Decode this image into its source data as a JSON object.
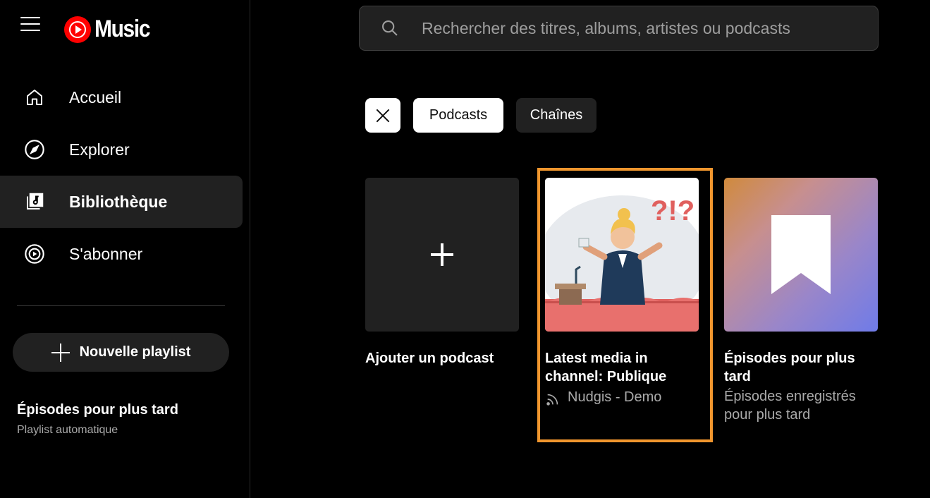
{
  "app": {
    "logo_text": "Music",
    "brand_color": "#ff0000",
    "highlight_color": "#f0962e"
  },
  "sidebar": {
    "items": [
      {
        "label": "Accueil",
        "icon": "home-icon",
        "active": false
      },
      {
        "label": "Explorer",
        "icon": "compass-icon",
        "active": false
      },
      {
        "label": "Bibliothèque",
        "icon": "library-icon",
        "active": true
      },
      {
        "label": "S'abonner",
        "icon": "subscriptions-icon",
        "active": false
      }
    ],
    "new_playlist_label": "Nouvelle playlist",
    "saved_playlist": {
      "title": "Épisodes pour plus tard",
      "subtitle": "Playlist automatique"
    }
  },
  "search": {
    "placeholder": "Rechercher des titres, albums, artistes ou podcasts"
  },
  "filters": {
    "chips": [
      {
        "label": "Podcasts",
        "selected": true
      },
      {
        "label": "Chaînes",
        "selected": false
      }
    ]
  },
  "cards": [
    {
      "title": "Ajouter un podcast",
      "icon": "add-icon"
    },
    {
      "title_line1": "Latest media in",
      "title_line2": "channel: Publique",
      "subtitle": "Nudgis - Demo",
      "icon": "rss-icon",
      "art_text": "?!?"
    },
    {
      "title_line1": "Épisodes pour plus",
      "title_line2": "tard",
      "subtitle_line1": "Épisodes enregistrés",
      "subtitle_line2": "pour plus tard",
      "icon": "bookmark-icon"
    }
  ]
}
